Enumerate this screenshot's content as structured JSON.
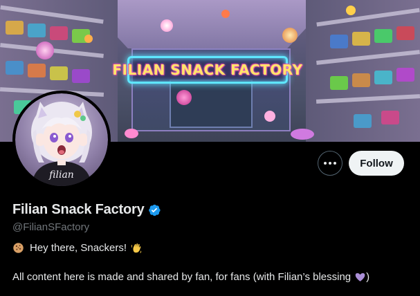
{
  "banner": {
    "sign_text": "FILIAN SNACK FACTORY"
  },
  "profile": {
    "display_name": "Filian Snack Factory",
    "handle": "@FilianSFactory",
    "avatar_text": "filian",
    "bio_line1_text": "Hey there, Snackers!",
    "bio_line1_lead_icon": "cookie-icon",
    "bio_line1_trail_icon": "waving-hand-icon",
    "bio_line2_text": "All content here is made and shared by fan, for fans (with Filian’s blessing",
    "bio_line2_icon": "purple-heart-icon",
    "bio_line2_close": ")"
  },
  "actions": {
    "more_icon": "ellipsis-icon",
    "follow_label": "Follow"
  },
  "colors": {
    "background": "#000000",
    "text_primary": "#e7e9ea",
    "text_secondary": "#71767b",
    "verified_blue": "#1d9bf0",
    "follow_button_bg": "#eff3f4",
    "neon_sign_border": "#5fe6ff",
    "neon_sign_text": "#ffe56a"
  }
}
